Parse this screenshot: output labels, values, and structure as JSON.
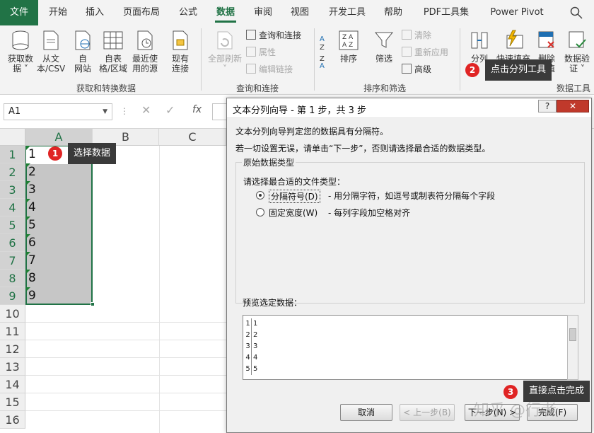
{
  "tabs": [
    "文件",
    "开始",
    "插入",
    "页面布局",
    "公式",
    "数据",
    "审阅",
    "视图",
    "开发工具",
    "帮助",
    "PDF工具集",
    "Power Pivot"
  ],
  "active_tab": "数据",
  "ribbon": {
    "get_transform": {
      "btn1": "获取数",
      "btn1b": "据 ˅",
      "btn2": "从文",
      "btn2b": "本/CSV",
      "btn3": "自",
      "btn3b": "网站",
      "btn4": "自表",
      "btn4b": "格/区域",
      "btn5": "最近使",
      "btn5b": "用的源",
      "btn6": "现有",
      "btn6b": "连接",
      "label": "获取和转换数据"
    },
    "queries": {
      "refresh": "全部刷新",
      "refresh_b": "˅",
      "q1": "查询和连接",
      "q2": "属性",
      "q3": "编辑链接",
      "label": "查询和连接"
    },
    "sort_filter": {
      "sort": "排序",
      "filter": "筛选",
      "clear": "清除",
      "reapply": "重新应用",
      "advanced": "高级",
      "label": "排序和筛选"
    },
    "tools": {
      "split": "分列",
      "flash": "快速填充",
      "remove_dup": "删除",
      "remove_dup_b": "复值",
      "validate": "数据验",
      "validate_b": "证 ˅",
      "label": "数据工具"
    }
  },
  "namebox": "A1",
  "fx": "fx",
  "sheet": {
    "columns": [
      "A",
      "B",
      "C"
    ],
    "rows": [
      "1",
      "2",
      "3",
      "4",
      "5",
      "6",
      "7",
      "8",
      "9",
      "10",
      "11",
      "12",
      "13",
      "14",
      "15",
      "16"
    ],
    "cells": [
      "1",
      "2",
      "3",
      "4",
      "5",
      "6",
      "7",
      "8",
      "9"
    ]
  },
  "callouts": {
    "c1_num": "1",
    "c1_text": "选择数据",
    "c2_num": "2",
    "c2_text": "点击分列工具",
    "c3_num": "3",
    "c3_text": "直接点击完成"
  },
  "dialog": {
    "title": "文本分列向导 - 第 1 步，共 3 步",
    "help": "?",
    "close": "✕",
    "line1": "文本分列向导判定您的数据具有分隔符。",
    "line2": "若一切设置无误，请单击“下一步”，否则请选择最合适的数据类型。",
    "legend": "原始数据类型",
    "prompt": "请选择最合适的文件类型：",
    "opt1": "分隔符号(D)",
    "opt1_desc": "- 用分隔字符，如逗号或制表符分隔每个字段",
    "opt2": "固定宽度(W)",
    "opt2_desc": "- 每列字段加空格对齐",
    "preview_label": "预览选定数据：",
    "preview_rows": [
      {
        "n": "1",
        "v": "1"
      },
      {
        "n": "2",
        "v": "2"
      },
      {
        "n": "3",
        "v": "3"
      },
      {
        "n": "4",
        "v": "4"
      },
      {
        "n": "5",
        "v": "5"
      }
    ],
    "btn_cancel": "取消",
    "btn_back": "< 上一步(B)",
    "btn_next": "下一步(N) >",
    "btn_finish": "完成(F)"
  },
  "watermark": "知乎 @行者"
}
